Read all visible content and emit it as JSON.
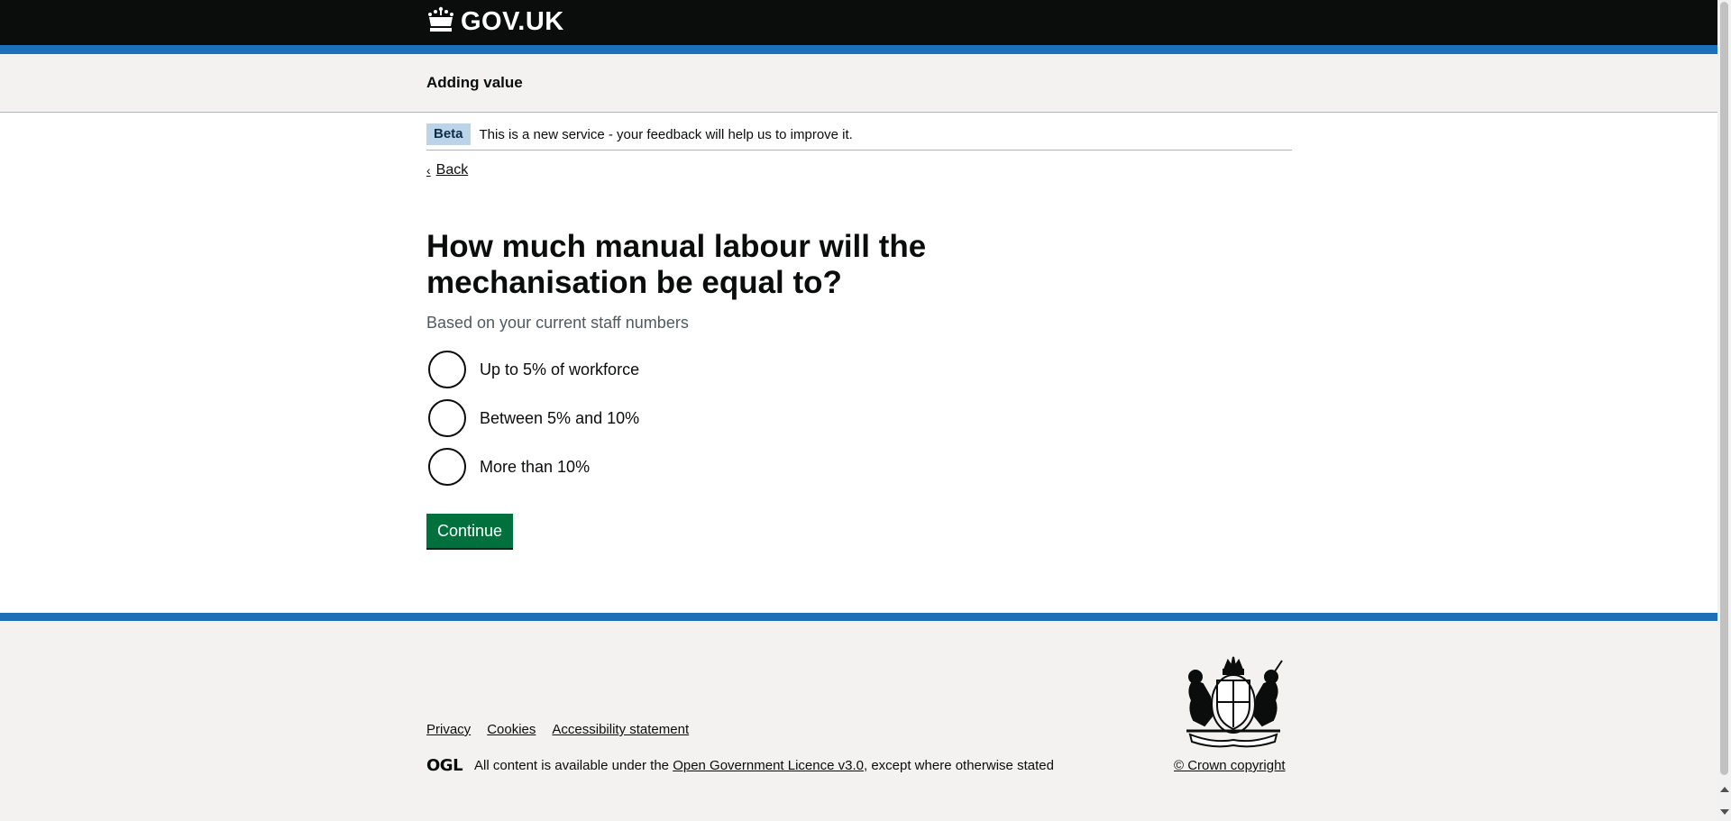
{
  "header": {
    "logo_text": "GOV.UK",
    "logo_icon": "crown-icon"
  },
  "service": {
    "name": "Adding value"
  },
  "phase_banner": {
    "tag": "Beta",
    "text": "This is a new service - your feedback will help us to improve it."
  },
  "back_link": "Back",
  "question": {
    "heading": "How much manual labour will the mechanisation be equal to?",
    "hint": "Based on your current staff numbers",
    "options": [
      {
        "label": "Up to 5% of workforce",
        "selected": false
      },
      {
        "label": "Between 5% and 10%",
        "selected": false
      },
      {
        "label": "More than 10%",
        "selected": false
      }
    ]
  },
  "continue_label": "Continue",
  "footer": {
    "links": [
      "Privacy",
      "Cookies",
      "Accessibility statement"
    ],
    "ogl_logo": "OGL",
    "licence_prefix": "All content is available under the ",
    "licence_link": "Open Government Licence v3.0",
    "licence_suffix": ", except where otherwise stated",
    "crest_icon": "royal-coat-of-arms-icon",
    "copyright": "© Crown copyright"
  },
  "colors": {
    "header_bg": "#0b0c0c",
    "brand_blue": "#1d70b8",
    "button_green": "#00703c",
    "footer_bg": "#f3f2f1"
  }
}
